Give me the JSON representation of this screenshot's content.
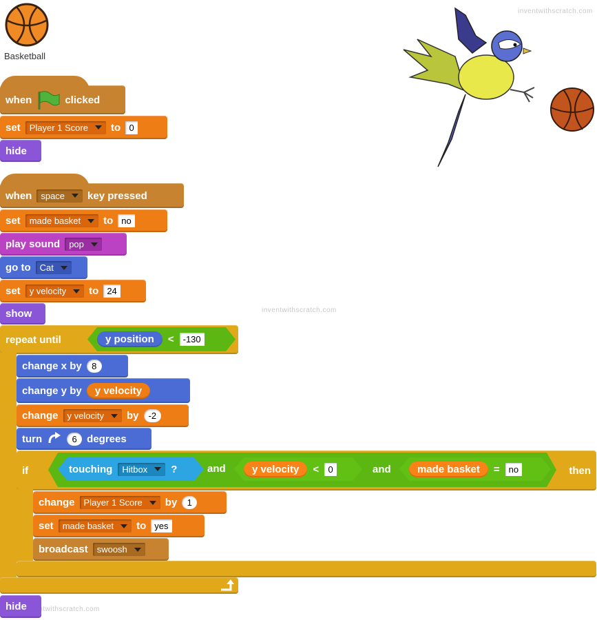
{
  "watermark": "inventwithscratch.com",
  "sprite": {
    "name": "Basketball",
    "icon": "basketball-icon"
  },
  "script1": {
    "when_text": "when",
    "flag_icon": "green-flag-icon",
    "clicked_text": "clicked",
    "set_text": "set",
    "var": "Player 1 Score",
    "to_text": "to",
    "value": "0",
    "hide_text": "hide"
  },
  "script2": {
    "when_text": "when",
    "key": "space",
    "key_pressed_text": "key pressed",
    "set1_text": "set",
    "set1_var": "made basket",
    "set1_to": "to",
    "set1_value": "no",
    "play_sound_text": "play sound",
    "sound": "pop",
    "go_to_text": "go to",
    "go_to_target": "Cat",
    "set2_text": "set",
    "set2_var": "y velocity",
    "set2_to": "to",
    "set2_value": "24",
    "show_text": "show",
    "repeat_until_text": "repeat until",
    "y_position_text": "y position",
    "lt": "<",
    "threshold": "-130",
    "change_x_text": "change x by",
    "change_x_value": "8",
    "change_y_text": "change y by",
    "change_y_reporter": "y velocity",
    "change_var_text": "change",
    "change_var": "y velocity",
    "change_var_by": "by",
    "change_var_value": "-2",
    "turn_text": "turn",
    "turn_icon": "rotate-clockwise-icon",
    "turn_value": "6",
    "degrees_text": "degrees",
    "if_text": "if",
    "touching_text": "touching",
    "touching_target": "Hitbox",
    "q": "?",
    "and1": "and",
    "yv_reporter": "y velocity",
    "lt2": "<",
    "yv_value": "0",
    "and2": "and",
    "mb_reporter": "made basket",
    "eq": "=",
    "mb_value": "no",
    "then_text": "then",
    "inc_text": "change",
    "inc_var": "Player 1 Score",
    "inc_by": "by",
    "inc_value": "1",
    "set3_text": "set",
    "set3_var": "made basket",
    "set3_to": "to",
    "set3_value": "yes",
    "broadcast_text": "broadcast",
    "broadcast_msg": "swoosh",
    "loop_icon": "loop-arrow-icon",
    "hide_text": "hide"
  }
}
